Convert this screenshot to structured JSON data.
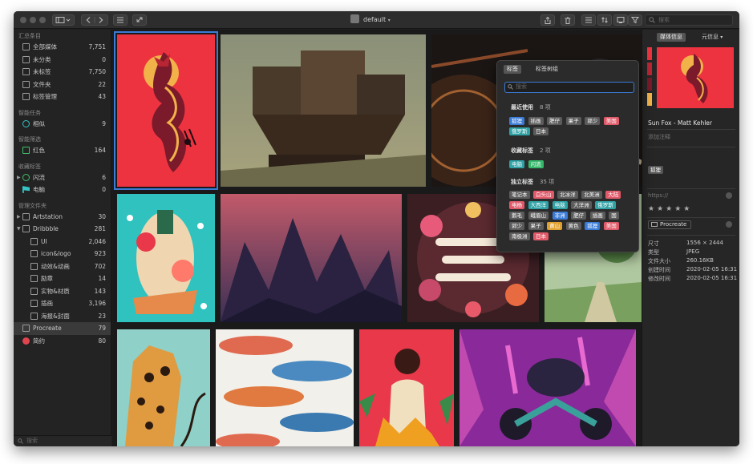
{
  "toolbar": {
    "library_name": "default",
    "search_placeholder": "搜索"
  },
  "sidebar": {
    "sections": [
      {
        "title": "汇总条目",
        "items": [
          {
            "label": "全部媒体",
            "count": "7,751"
          },
          {
            "label": "未分类",
            "count": "0"
          },
          {
            "label": "未标签",
            "count": "7,750"
          },
          {
            "label": "文件夹",
            "count": "22"
          },
          {
            "label": "标签管理",
            "count": "43"
          }
        ]
      },
      {
        "title": "智能任务",
        "items": [
          {
            "label": "相似",
            "count": "9"
          }
        ]
      },
      {
        "title": "智能筛选",
        "items": [
          {
            "label": "红色",
            "count": "164"
          }
        ]
      },
      {
        "title": "收藏标签",
        "items": [
          {
            "label": "闪流",
            "count": "6"
          },
          {
            "label": "电脑",
            "count": "0"
          }
        ]
      },
      {
        "title": "管理文件夹",
        "items": [
          {
            "label": "Artstation",
            "count": "30"
          },
          {
            "label": "Dribbble",
            "count": "281"
          },
          {
            "label": "UI",
            "count": "2,046"
          },
          {
            "label": "icon&logo",
            "count": "923"
          },
          {
            "label": "动效&动画",
            "count": "702"
          },
          {
            "label": "励章",
            "count": "14"
          },
          {
            "label": "实物&材质",
            "count": "143"
          },
          {
            "label": "插画",
            "count": "3,196"
          },
          {
            "label": "海报&封面",
            "count": "23"
          },
          {
            "label": "Procreate",
            "count": "79"
          },
          {
            "label": "简约",
            "count": "80"
          }
        ]
      }
    ],
    "search_placeholder": "搜索"
  },
  "tag_popup": {
    "tabs": [
      "标签",
      "标签树组"
    ],
    "search_placeholder": "搜索",
    "recent": {
      "title": "最近使用",
      "count": "8 项",
      "tags": [
        "狐狸",
        "插画",
        "肥仔",
        "果子",
        "郭少",
        "美国",
        "俄罗斯",
        "日本"
      ]
    },
    "favorites": {
      "title": "收藏标签",
      "count": "2 项",
      "tags": [
        "电脑",
        "闪流"
      ]
    },
    "standalone": {
      "title": "独立标签",
      "count": "35 项",
      "tags": [
        "笔记本",
        "白头山",
        "北冰洋",
        "北美洲",
        "大陆",
        "电杨",
        "大西洋",
        "电脑",
        "大洋洲",
        "俄罗斯",
        "鹅毛",
        "峨眉山",
        "非洲",
        "肥仔",
        "插画",
        "国",
        "郭少",
        "果子",
        "黄山",
        "黄色",
        "狐狸",
        "美国",
        "南极洲",
        "日本"
      ]
    }
  },
  "inspector": {
    "tabs": [
      "媒体信息",
      "元信息"
    ],
    "title": "Sun Fox - Matt Kehler",
    "annotation_placeholder": "添加注释",
    "tag": "狐狸",
    "url_placeholder": "https://",
    "folder": "Procreate",
    "swatches": [
      "#e8333f",
      "#b82634",
      "#7a1a2a",
      "#f2b24a"
    ],
    "meta": [
      {
        "label": "尺寸",
        "value": "1556 × 2444"
      },
      {
        "label": "类型",
        "value": "JPEG"
      },
      {
        "label": "文件大小",
        "value": "260.16KB"
      },
      {
        "label": "创建时间",
        "value": "2020-02-05 16:31"
      },
      {
        "label": "修改时间",
        "value": "2020-02-05 16:31"
      }
    ]
  }
}
